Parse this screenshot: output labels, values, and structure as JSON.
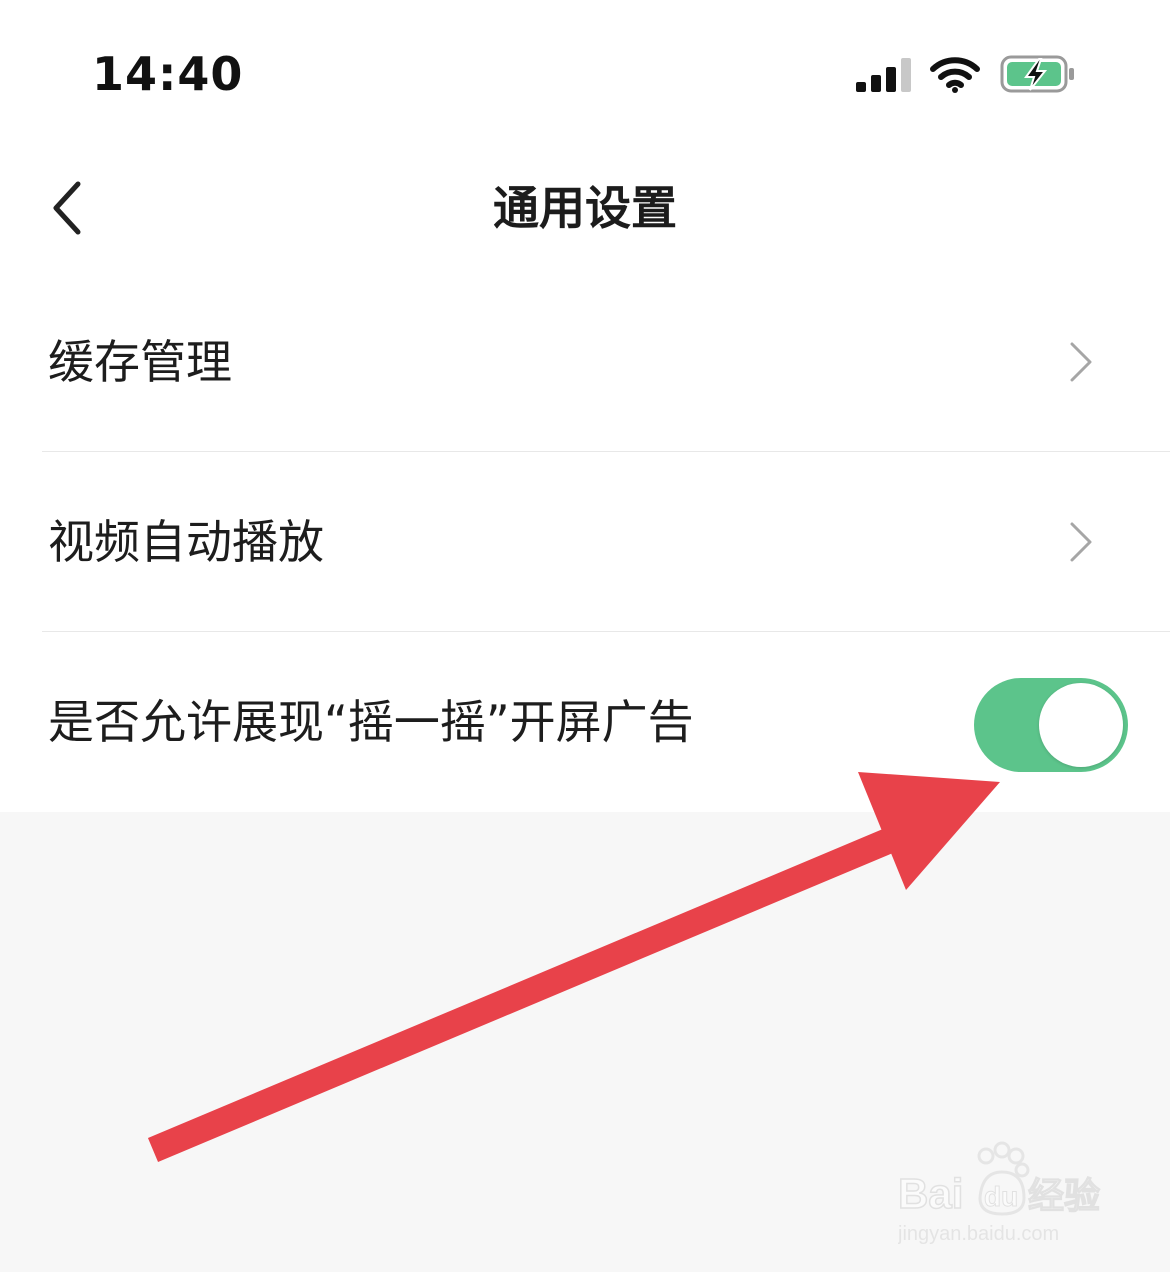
{
  "status_bar": {
    "time": "14:40",
    "icons": [
      "signal-icon",
      "wifi-icon",
      "battery-charging-icon"
    ]
  },
  "nav": {
    "title": "通用设置",
    "back_icon": "chevron-left-icon"
  },
  "settings": {
    "items": [
      {
        "label": "缓存管理",
        "control": "chevron-right-icon"
      },
      {
        "label": "视频自动播放",
        "control": "chevron-right-icon"
      },
      {
        "label": "是否允许展现“摇一摇”开屏广告",
        "control": "toggle",
        "toggle_on": true
      }
    ]
  },
  "annotation": {
    "arrow_color": "#e8424a",
    "points_to": "toggle"
  },
  "watermark": {
    "brand": "Baidu经验",
    "url": "jingyan.baidu.com"
  },
  "colors": {
    "toggle_on": "#5cc48b",
    "background_gray": "#f7f7f7",
    "battery_fill": "#5cc48b"
  }
}
